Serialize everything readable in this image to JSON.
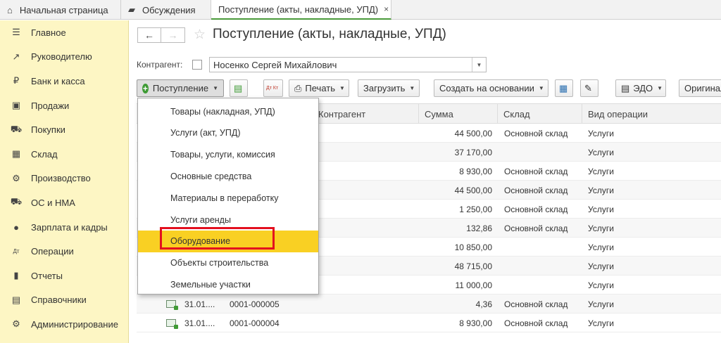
{
  "tabs": [
    {
      "icon": "home-icon",
      "label": "Начальная страница"
    },
    {
      "icon": "chat-icon",
      "label": "Обсуждения"
    },
    {
      "icon": "",
      "label": "Поступление (акты, накладные, УПД)",
      "active": true,
      "close": "×"
    }
  ],
  "sidebar": {
    "items": [
      {
        "icon": "menu-icon",
        "glyph": "☰",
        "label": "Главное"
      },
      {
        "icon": "trend-icon",
        "glyph": "↗",
        "label": "Руководителю"
      },
      {
        "icon": "ruble-icon",
        "glyph": "₽",
        "label": "Банк и касса"
      },
      {
        "icon": "bag-icon",
        "glyph": "▣",
        "label": "Продажи"
      },
      {
        "icon": "cart-icon",
        "glyph": "⛟",
        "label": "Покупки"
      },
      {
        "icon": "warehouse-icon",
        "glyph": "▦",
        "label": "Склад"
      },
      {
        "icon": "factory-icon",
        "glyph": "⚙",
        "label": "Производство"
      },
      {
        "icon": "truck-icon",
        "glyph": "⛟",
        "label": "ОС и НМА"
      },
      {
        "icon": "person-icon",
        "glyph": "●",
        "label": "Зарплата и кадры"
      },
      {
        "icon": "dt-kt-icon",
        "glyph": "Дт",
        "label": "Операции"
      },
      {
        "icon": "bar-chart-icon",
        "glyph": "▮",
        "label": "Отчеты"
      },
      {
        "icon": "book-icon",
        "glyph": "▤",
        "label": "Справочники"
      },
      {
        "icon": "gear-icon",
        "glyph": "⚙",
        "label": "Администрирование"
      }
    ]
  },
  "header": {
    "back": "←",
    "forward": "→",
    "star": "☆",
    "title": "Поступление (акты, накладные, УПД)"
  },
  "filter": {
    "label": "Контрагент:",
    "value": "Носенко Сергей Михайлович"
  },
  "toolbar": {
    "postuplenie": "Поступление",
    "print": "Печать",
    "load": "Загрузить",
    "create_based": "Создать на основании",
    "edo": "ЭДО",
    "original": "Оригинал",
    "dtkt": "Дт Кт"
  },
  "table": {
    "columns": [
      "Контрагент",
      "Сумма",
      "Склад",
      "Вид операции"
    ],
    "rows": [
      {
        "date": "",
        "number": "",
        "sum": "44 500,00",
        "warehouse": "Основной склад",
        "op": "Услуги"
      },
      {
        "date": "",
        "number": "",
        "sum": "37 170,00",
        "warehouse": "",
        "op": "Услуги"
      },
      {
        "date": "",
        "number": "",
        "sum": "8 930,00",
        "warehouse": "Основной склад",
        "op": "Услуги"
      },
      {
        "date": "",
        "number": "",
        "sum": "44 500,00",
        "warehouse": "Основной склад",
        "op": "Услуги"
      },
      {
        "date": "",
        "number": "",
        "sum": "1 250,00",
        "warehouse": "Основной склад",
        "op": "Услуги"
      },
      {
        "date": "",
        "number": "",
        "sum": "132,86",
        "warehouse": "Основной склад",
        "op": "Услуги"
      },
      {
        "date": "",
        "number": "",
        "sum": "10 850,00",
        "warehouse": "",
        "op": "Услуги"
      },
      {
        "date": "",
        "number": "",
        "sum": "48 715,00",
        "warehouse": "",
        "op": "Услуги"
      },
      {
        "date": "",
        "number": "",
        "sum": "11 000,00",
        "warehouse": "",
        "op": "Услуги"
      },
      {
        "date": "31.01....",
        "number": "0001-000005",
        "sum": "4,36",
        "warehouse": "Основной склад",
        "op": "Услуги"
      },
      {
        "date": "31.01....",
        "number": "0001-000004",
        "sum": "8 930,00",
        "warehouse": "Основной склад",
        "op": "Услуги"
      }
    ]
  },
  "dropdown": {
    "items": [
      "Товары (накладная, УПД)",
      "Услуги (акт, УПД)",
      "Товары, услуги, комиссия",
      "Основные средства",
      "Материалы в переработку",
      "Услуги аренды",
      "Оборудование",
      "Объекты строительства",
      "Земельные участки"
    ],
    "selected_index": 6
  },
  "colors": {
    "sidebar_bg": "#fdf6c4",
    "selected_item": "#f9d023",
    "highlight_border": "#e3101e",
    "accent_green": "#3f9b35"
  }
}
